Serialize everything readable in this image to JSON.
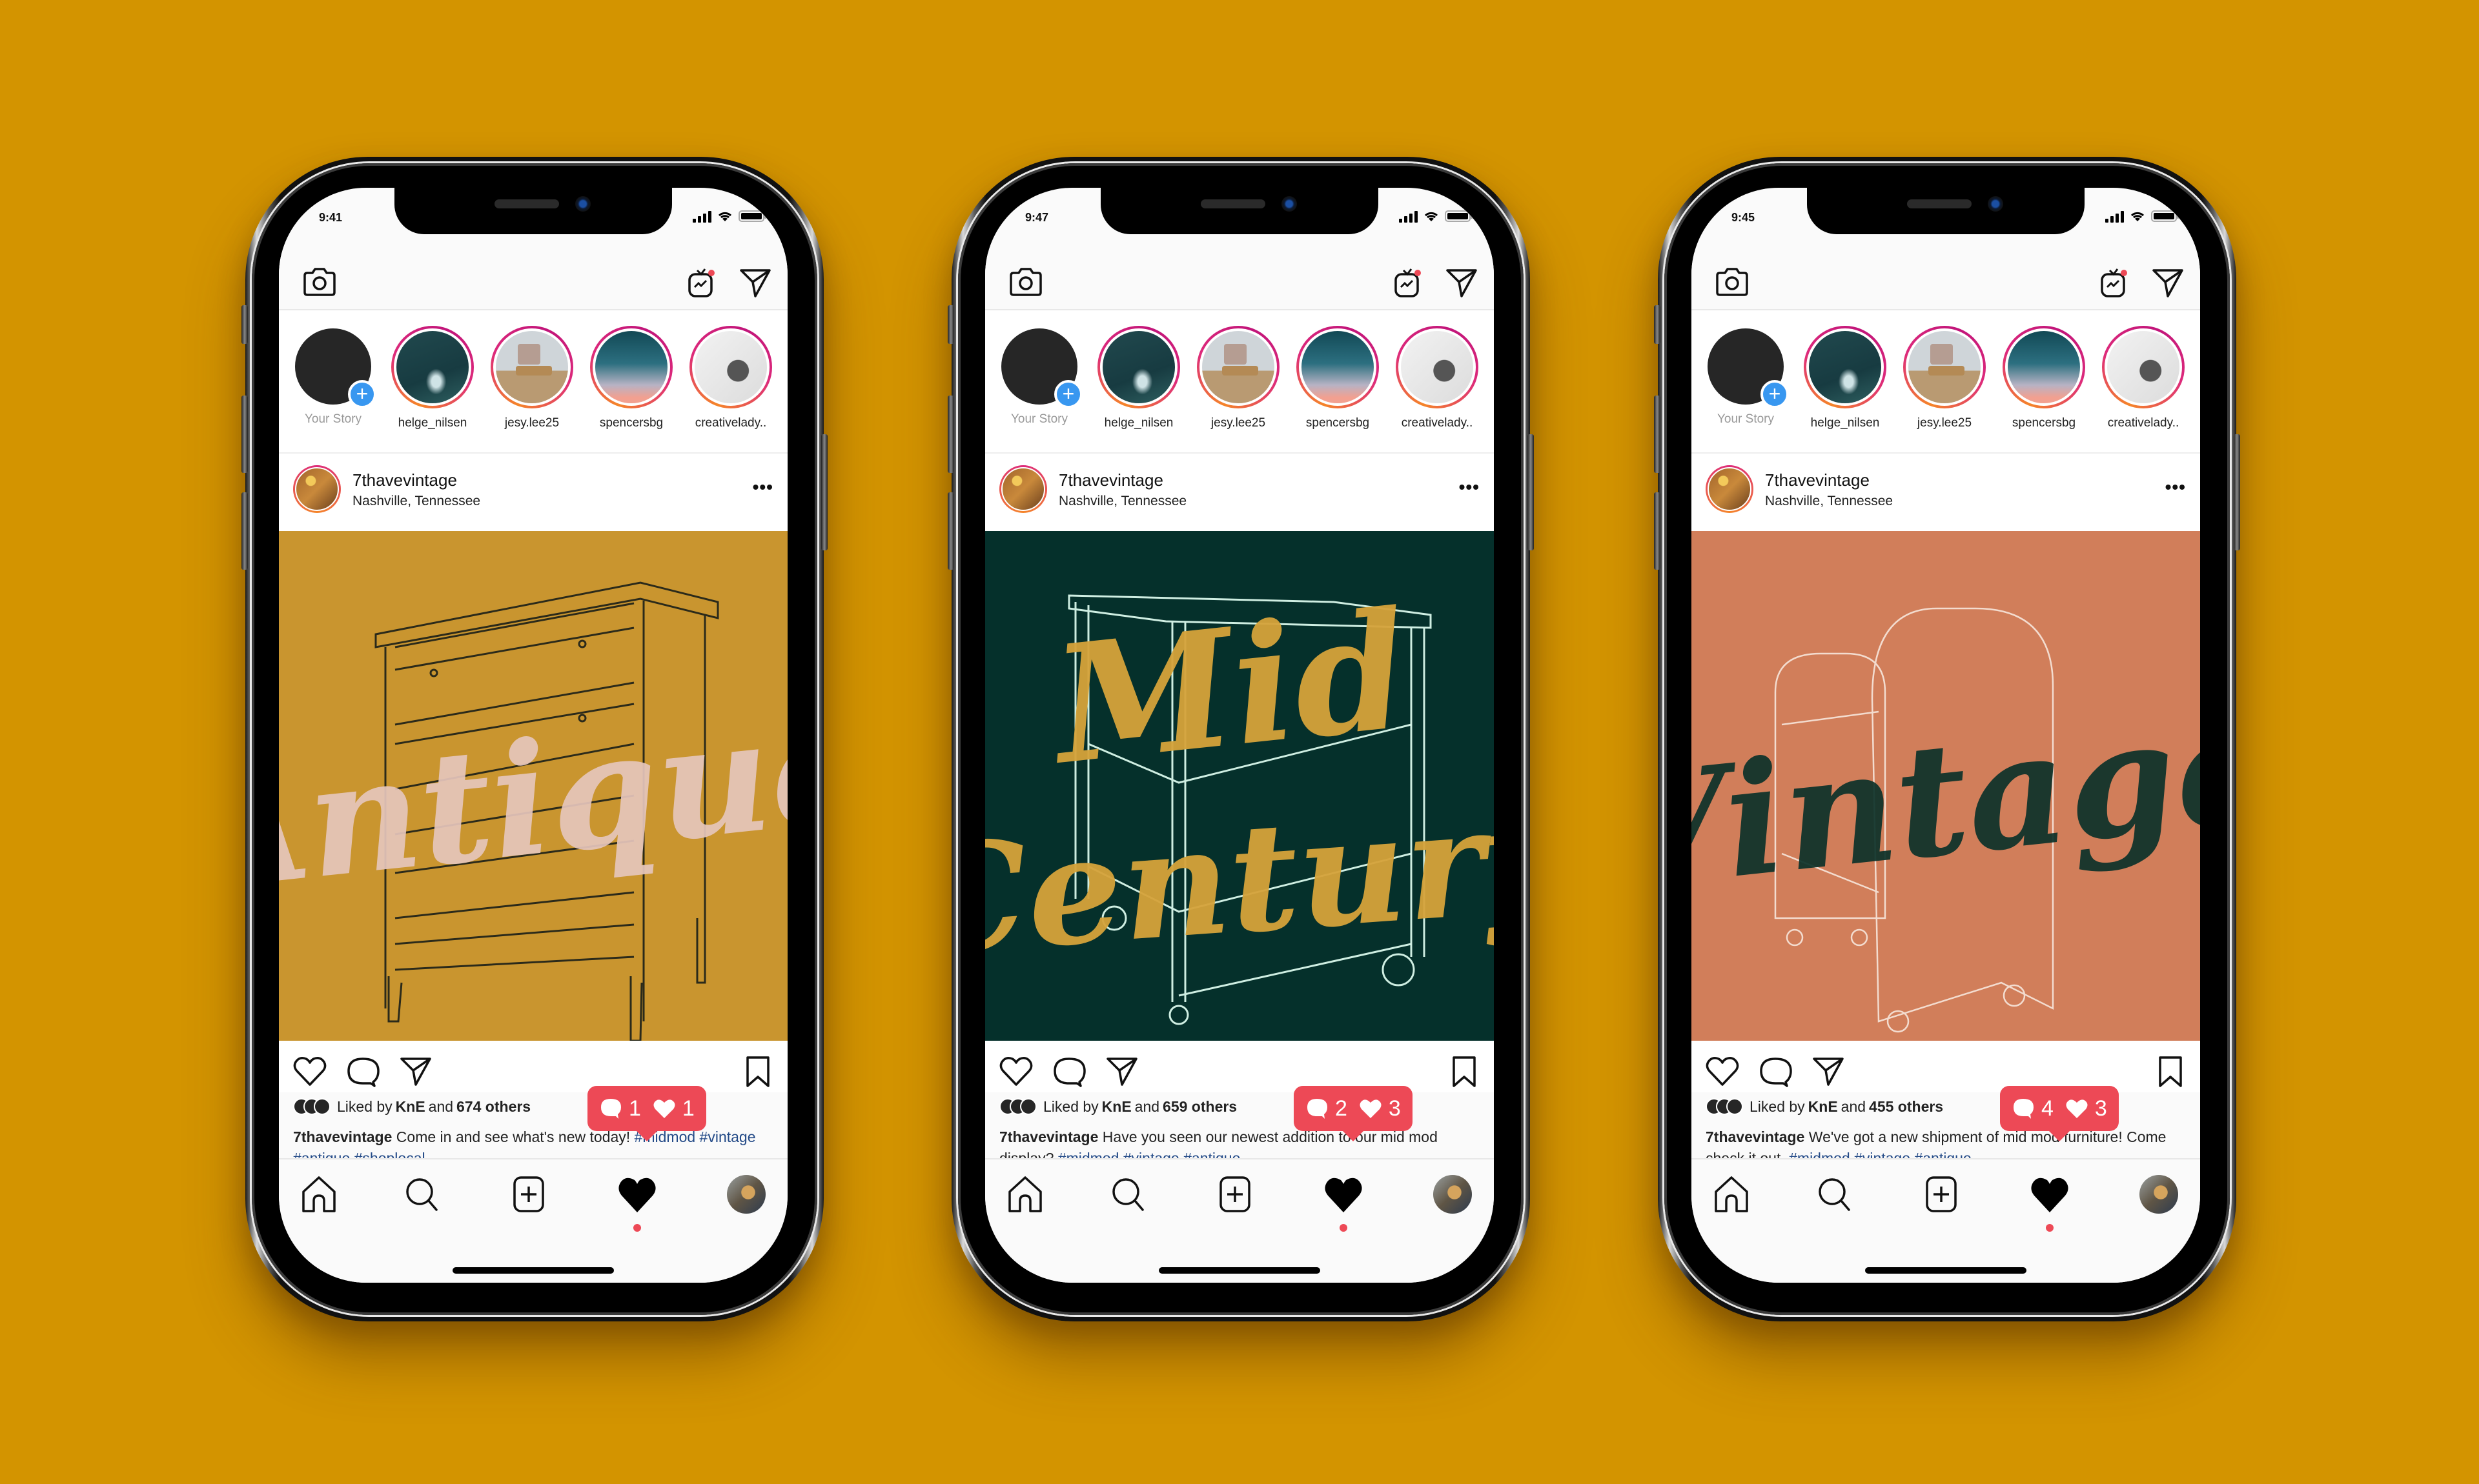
{
  "background_color": "#d39400",
  "accent": {
    "activity_red": "#ed4956",
    "story_plus_blue": "#3897f0",
    "hashtag_blue": "#234a87"
  },
  "phones": [
    {
      "status_time": "9:41",
      "stories": [
        {
          "label": "Your Story",
          "own": true
        },
        {
          "label": "helge_nilsen",
          "thumb": "ocean"
        },
        {
          "label": "jesy.lee25",
          "thumb": "chair"
        },
        {
          "label": "spencersbg",
          "thumb": "sky"
        },
        {
          "label": "creativelady..",
          "thumb": "lamp"
        }
      ],
      "post": {
        "username": "7thavevintage",
        "location": "Nashville, Tennessee",
        "more_label": "•••",
        "image": {
          "word": "Antique",
          "bg": "#c9952f",
          "ink": "#e6c6bc",
          "line": "#2b2a1a",
          "furniture": "dresser"
        },
        "liked_prefix": "Liked by",
        "liked_user": "KnE",
        "liked_and": "and",
        "liked_count": "674 others",
        "caption_user": "7thavevintage",
        "caption_text": "Come in and see what's new today!",
        "hashtags": "#midmod #vintage #antique #shoplocal"
      },
      "activity": {
        "comments": "1",
        "likes": "1"
      }
    },
    {
      "status_time": "9:47",
      "stories": [
        {
          "label": "Your Story",
          "own": true
        },
        {
          "label": "helge_nilsen",
          "thumb": "ocean"
        },
        {
          "label": "jesy.lee25",
          "thumb": "chair"
        },
        {
          "label": "spencersbg",
          "thumb": "sky"
        },
        {
          "label": "creativelady..",
          "thumb": "lamp"
        }
      ],
      "post": {
        "username": "7thavevintage",
        "location": "Nashville, Tennessee",
        "more_label": "•••",
        "image": {
          "word": "Mid Century",
          "bg": "#05302b",
          "ink": "#d6a33a",
          "line": "#cfeee2",
          "furniture": "cart"
        },
        "liked_prefix": "Liked by",
        "liked_user": "KnE",
        "liked_and": "and",
        "liked_count": "659 others",
        "caption_user": "7thavevintage",
        "caption_text": "Have you seen our newest addition to our mid mod display?",
        "hashtags": "#midmod #vintage #antique"
      },
      "activity": {
        "comments": "2",
        "likes": "3"
      }
    },
    {
      "status_time": "9:45",
      "stories": [
        {
          "label": "Your Story",
          "own": true
        },
        {
          "label": "helge_nilsen",
          "thumb": "ocean"
        },
        {
          "label": "jesy.lee25",
          "thumb": "chair"
        },
        {
          "label": "spencersbg",
          "thumb": "sky"
        },
        {
          "label": "creativelady..",
          "thumb": "lamp"
        }
      ],
      "post": {
        "username": "7thavevintage",
        "location": "Nashville, Tennessee",
        "more_label": "•••",
        "image": {
          "word": "Vintage",
          "bg": "#d17e5a",
          "ink": "#0c322a",
          "line": "#f3dccf",
          "furniture": "cabinet"
        },
        "liked_prefix": "Liked by",
        "liked_user": "KnE",
        "liked_and": "and",
        "liked_count": "455 others",
        "caption_user": "7thavevintage",
        "caption_text": "We've got a new shipment of mid mod furniture! Come check it out.",
        "hashtags": "#midmod #vintage #antique"
      },
      "activity": {
        "comments": "4",
        "likes": "3"
      }
    }
  ],
  "icons": {
    "top_left": "camera-icon",
    "top_right": [
      "igtv-icon",
      "direct-message-icon"
    ],
    "post_actions": [
      "heart-outline-icon",
      "comment-icon",
      "share-icon",
      "bookmark-icon"
    ],
    "bottom_nav": [
      "home-icon",
      "search-icon",
      "new-post-icon",
      "activity-heart-icon",
      "profile-avatar"
    ]
  }
}
